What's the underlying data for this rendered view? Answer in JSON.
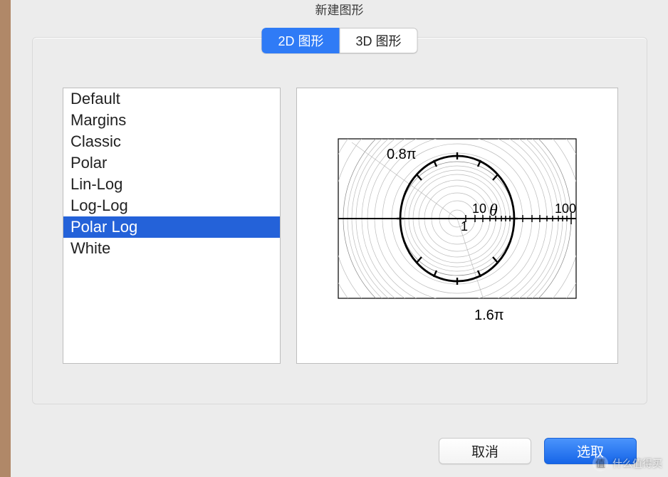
{
  "window": {
    "title": "新建图形"
  },
  "tabs": {
    "items": [
      {
        "label": "2D 图形",
        "active": true
      },
      {
        "label": "3D 图形",
        "active": false
      }
    ]
  },
  "list": {
    "items": [
      {
        "label": "Default"
      },
      {
        "label": "Margins"
      },
      {
        "label": "Classic"
      },
      {
        "label": "Polar"
      },
      {
        "label": "Lin-Log"
      },
      {
        "label": "Log-Log"
      },
      {
        "label": "Polar Log",
        "selected": true
      },
      {
        "label": "White"
      }
    ]
  },
  "preview": {
    "angle_top_label": "0.8π",
    "angle_bottom_label": "1.6π",
    "center_r_label": "1",
    "axis_label": "θ",
    "tick_10": "10",
    "tick_100": "100"
  },
  "footer": {
    "cancel": "取消",
    "choose": "选取"
  },
  "watermark": {
    "badge": "值",
    "text": "什么值得买"
  }
}
